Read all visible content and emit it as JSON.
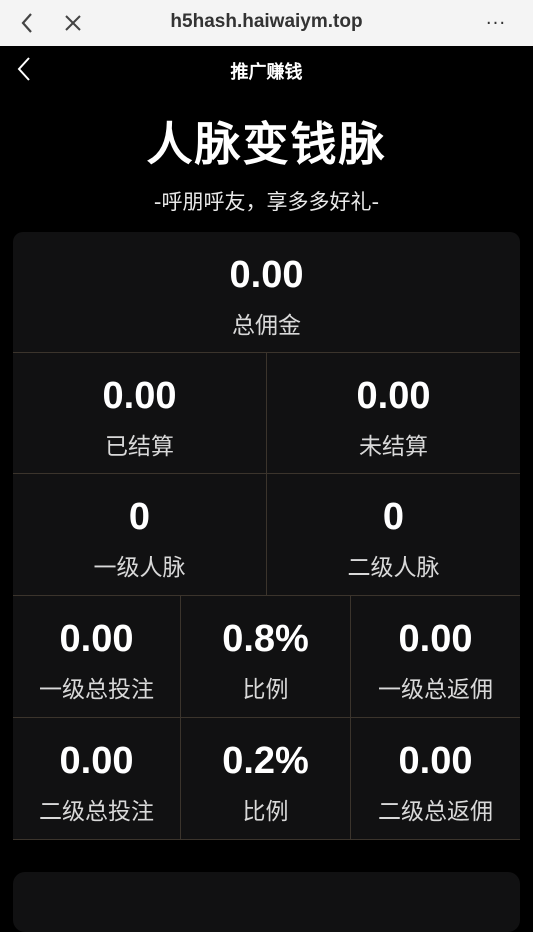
{
  "browser": {
    "url": "h5hash.haiwaiym.top",
    "more_label": "···"
  },
  "header": {
    "title": "推广赚钱"
  },
  "hero": {
    "title": "人脉变钱脉",
    "subtitle": "-呼朋呼友，享多多好礼-"
  },
  "stats": {
    "total": {
      "value": "0.00",
      "label": "总佣金"
    },
    "settled": {
      "value": "0.00",
      "label": "已结算"
    },
    "unsettled": {
      "value": "0.00",
      "label": "未结算"
    },
    "level1_contacts": {
      "value": "0",
      "label": "一级人脉"
    },
    "level2_contacts": {
      "value": "0",
      "label": "二级人脉"
    },
    "level1_bet": {
      "value": "0.00",
      "label": "一级总投注"
    },
    "level1_ratio": {
      "value": "0.8%",
      "label": "比例"
    },
    "level1_rebate": {
      "value": "0.00",
      "label": "一级总返佣"
    },
    "level2_bet": {
      "value": "0.00",
      "label": "二级总投注"
    },
    "level2_ratio": {
      "value": "0.2%",
      "label": "比例"
    },
    "level2_rebate": {
      "value": "0.00",
      "label": "二级总返佣"
    }
  },
  "colors": {
    "background": "#000000",
    "card": "#111112",
    "divider": "#3b342c",
    "browser_bar": "#f4f4f4"
  }
}
